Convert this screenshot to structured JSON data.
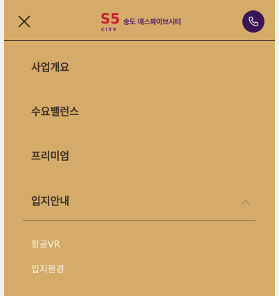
{
  "header": {
    "logo_mark": "S5",
    "logo_sub": "CITY",
    "logo_text": "송도 에스파이브시티",
    "close_icon": "close-icon",
    "phone_icon": "phone-icon"
  },
  "menu": {
    "items": [
      {
        "label": "사업개요"
      },
      {
        "label": "수요밸런스"
      },
      {
        "label": "프리미엄"
      },
      {
        "label": "입지안내",
        "expanded": true
      }
    ],
    "submenu": [
      {
        "label": "항공VR"
      },
      {
        "label": "입지환경"
      }
    ]
  },
  "colors": {
    "panel_bg": "#d5ab6a",
    "phone_bg": "#3b1656",
    "logo_red": "#c8202f",
    "logo_purple": "#5a1f6e"
  }
}
